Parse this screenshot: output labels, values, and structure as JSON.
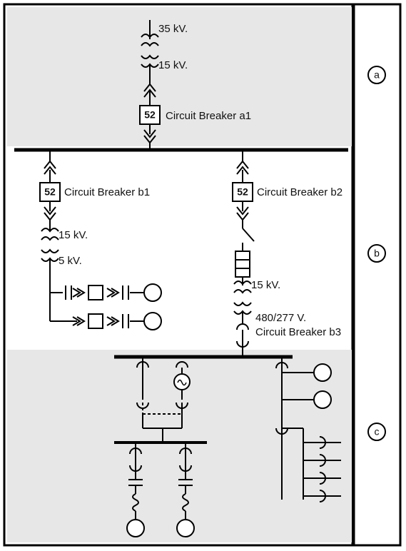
{
  "voltages": {
    "hv": "35 kV.",
    "mv": "15 kV.",
    "lv": "5 kV.",
    "ll": "480/277 V."
  },
  "breakers": {
    "code": "52",
    "a1": "Circuit Breaker a1",
    "b1": "Circuit Breaker b1",
    "b2": "Circuit Breaker b2",
    "b3": "Circuit Breaker b3"
  },
  "zones": {
    "a": "a",
    "b": "b",
    "c": "c"
  }
}
